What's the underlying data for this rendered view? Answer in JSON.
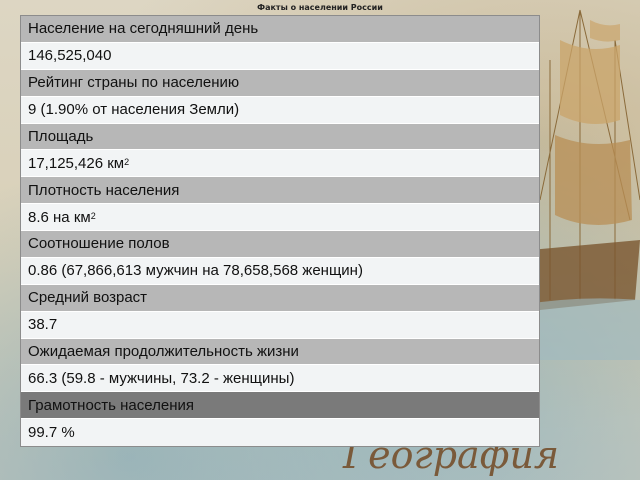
{
  "slide": {
    "title": "Факты о населении России"
  },
  "facts": [
    {
      "label": "Население на сегодняшний день",
      "value": "146,525,040"
    },
    {
      "label": "Рейтинг страны по населению",
      "value": "9 (1.90% от населения Земли)"
    },
    {
      "label": "Площадь",
      "value": "17,125,426 км",
      "value_sup": "2"
    },
    {
      "label": "Плотность населения",
      "value": "8.6 на км",
      "value_sup": "2"
    },
    {
      "label": "Соотношение полов",
      "value": "0.86 (67,866,613 мужчин на 78,658,568 женщин)"
    },
    {
      "label": "Средний возраст",
      "value": "38.7"
    },
    {
      "label": "Ожидаемая продолжительность жизни",
      "value": "66.3 (59.8 - мужчины, 73.2 - женщины)"
    },
    {
      "label": "Грамотность населения",
      "value": "99.7 %"
    }
  ],
  "decoration": {
    "word": "География"
  },
  "colors": {
    "label_row": "#b7b7b7",
    "label_row_highlight": "#7a7a7a",
    "value_row": "#f2f4f5"
  }
}
